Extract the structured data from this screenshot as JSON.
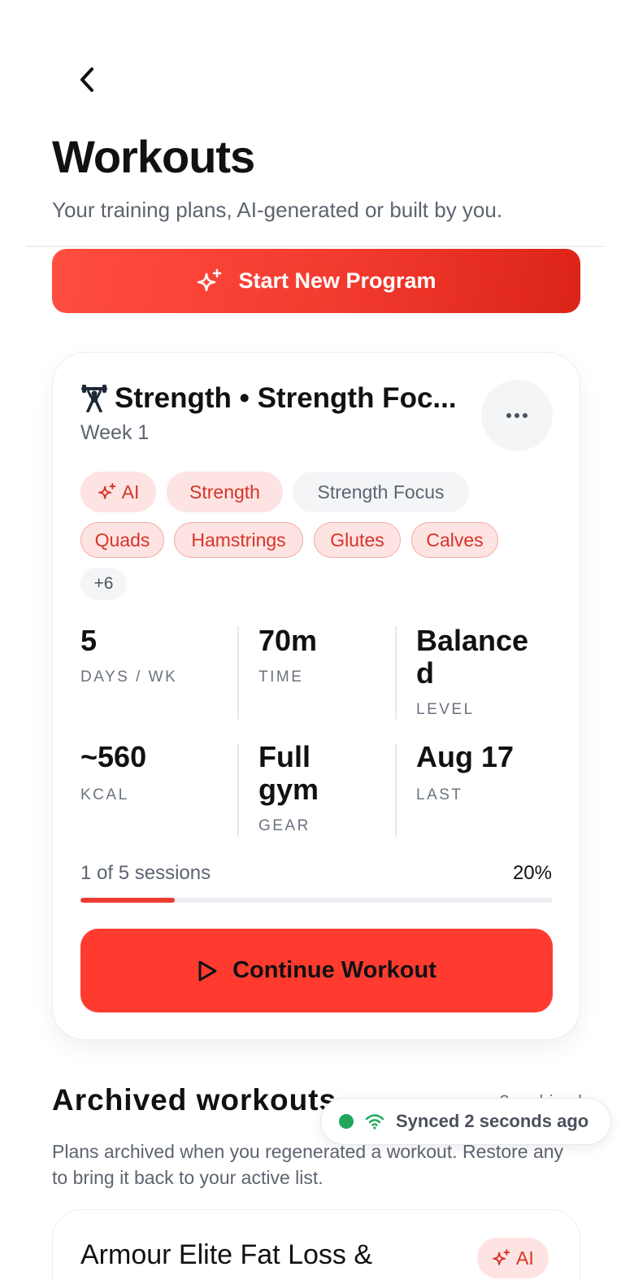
{
  "header": {
    "title": "Workouts",
    "subtitle": "Your training plans, AI-generated or built by you."
  },
  "actions": {
    "start_program_label": "Start New Program"
  },
  "active_program": {
    "title": "Strength • Strength Foc...",
    "week": "Week 1",
    "tags": {
      "ai": "AI",
      "type": "Strength",
      "focus": "Strength Focus"
    },
    "muscles": [
      "Quads",
      "Hamstrings",
      "Glutes",
      "Calves"
    ],
    "more_muscles": "+6",
    "stats": [
      {
        "value": "5",
        "label": "DAYS / WK"
      },
      {
        "value": "70m",
        "label": "TIME"
      },
      {
        "value": "Balance\nd",
        "label": "LEVEL"
      },
      {
        "value": "~560",
        "label": "KCAL"
      },
      {
        "value": "Full\ngym",
        "label": "GEAR"
      },
      {
        "value": "Aug 17",
        "label": "LAST"
      }
    ],
    "progress": {
      "sessions_text": "1 of 5 sessions",
      "percent_text": "20%",
      "fraction": 0.2
    },
    "continue_label": "Continue Workout"
  },
  "archived": {
    "title": "Archived workouts",
    "count_text": "3 archived",
    "description": "Plans archived when you regenerated a workout. Restore any to bring it back to your active list.",
    "items": [
      {
        "title": "Armour Elite Fat Loss &",
        "badge": "AI"
      }
    ]
  },
  "sync_toast": {
    "text": "Synced 2 seconds ago",
    "status_color": "#1fa85a"
  },
  "theme": {
    "accent": "#ff3b30",
    "accent_soft": "#fde4e2",
    "muted_text": "#5d6470"
  },
  "icons": {
    "back": "chevron-left-icon",
    "sparkle": "sparkles-icon",
    "lift": "weightlifter-icon",
    "more": "more-horizontal-icon",
    "play": "play-icon",
    "wifi": "wifi-icon"
  }
}
